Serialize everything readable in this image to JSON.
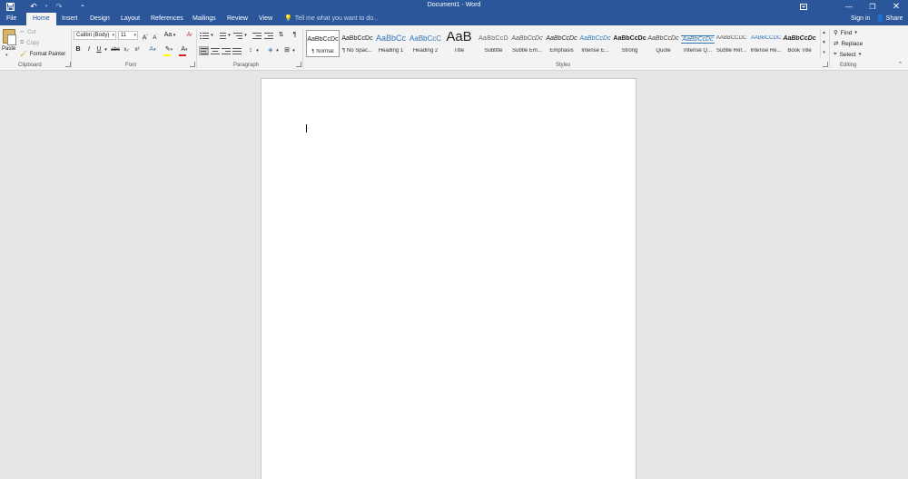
{
  "window": {
    "title": "Document1 - Word",
    "controls": [
      "ribbon-display-options",
      "minimize",
      "restore",
      "close"
    ]
  },
  "quick_access": [
    {
      "name": "save",
      "icon": "save-icon"
    },
    {
      "name": "undo",
      "icon": "undo-icon"
    },
    {
      "name": "redo",
      "icon": "redo-icon"
    },
    {
      "name": "customize",
      "icon": "customize-qat-icon"
    }
  ],
  "tabs": [
    {
      "label": "File"
    },
    {
      "label": "Home"
    },
    {
      "label": "Insert"
    },
    {
      "label": "Design"
    },
    {
      "label": "Layout"
    },
    {
      "label": "References"
    },
    {
      "label": "Mailings"
    },
    {
      "label": "Review"
    },
    {
      "label": "View"
    }
  ],
  "active_tab": "Home",
  "tell_me": "Tell me what you want to do...",
  "account": {
    "sign_in": "Sign in",
    "share": "Share"
  },
  "clipboard": {
    "paste": "Paste",
    "cut": "Cut",
    "copy": "Copy",
    "format_painter": "Format Painter",
    "label": "Clipboard"
  },
  "font": {
    "family": "Calibri (Body)",
    "size": "11",
    "change_case": "Aa",
    "label": "Font",
    "bold": "B",
    "italic": "I",
    "underline": "U",
    "strikethrough": "abc",
    "subscript": "x₂",
    "superscript": "x²",
    "highlight_color": "#ffff00",
    "font_color": "#e02020"
  },
  "paragraph": {
    "label": "Paragraph",
    "show_marks": "¶"
  },
  "styles": {
    "label": "Styles",
    "items": [
      {
        "preview": "AaBbCcDc",
        "name": "¶ Normal",
        "selected": true
      },
      {
        "preview": "AaBbCcDc",
        "name": "¶ No Spac..."
      },
      {
        "preview": "AaBbCc",
        "name": "Heading 1"
      },
      {
        "preview": "AaBbCcC",
        "name": "Heading 2"
      },
      {
        "preview": "AaB",
        "name": "Title"
      },
      {
        "preview": "AaBbCcD",
        "name": "Subtitle"
      },
      {
        "preview": "AaBbCcDc",
        "name": "Subtle Em..."
      },
      {
        "preview": "AaBbCcDc",
        "name": "Emphasis"
      },
      {
        "preview": "AaBbCcDc",
        "name": "Intense E..."
      },
      {
        "preview": "AaBbCcDc",
        "name": "Strong"
      },
      {
        "preview": "AaBbCcDc",
        "name": "Quote"
      },
      {
        "preview": "AaBbCcDc",
        "name": "Intense Q..."
      },
      {
        "preview": "AABBCCDC",
        "name": "Subtle Ref..."
      },
      {
        "preview": "AABBCCDC",
        "name": "Intense Re..."
      },
      {
        "preview": "AaBbCcDc",
        "name": "Book Title"
      }
    ]
  },
  "editing": {
    "label": "Editing",
    "find": "Find",
    "replace": "Replace",
    "select": "Select"
  },
  "colors": {
    "brand": "#2b579a",
    "ribbon": "#f3f3f3",
    "canvas": "#e6e6e6",
    "heading_blue": "#2e74b5"
  }
}
